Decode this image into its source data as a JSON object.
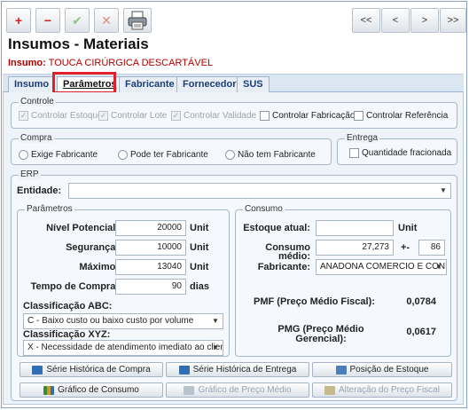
{
  "toolbar": {
    "add_glyph": "+",
    "remove_glyph": "−",
    "confirm_glyph": "✔",
    "cancel_glyph": "✕",
    "nav": [
      "<<",
      "<",
      ">",
      ">>"
    ]
  },
  "header": {
    "title": "Insumos - Materiais",
    "insumo_label": "Insumo:",
    "insumo_value": "TOUCA CIRÚRGICA DESCARTÁVEL"
  },
  "tabs": [
    "Insumo",
    "Parâmetros",
    "Fabricante",
    "Fornecedor",
    "SUS"
  ],
  "controle": {
    "legend": "Controle",
    "items": [
      "Controlar Estoque",
      "Controlar Lote",
      "Controlar Validade",
      "Controlar Fabricação",
      "Controlar Referência"
    ]
  },
  "compra": {
    "legend": "Compra",
    "options": [
      "Exige Fabricante",
      "Pode ter Fabricante",
      "Não tem Fabricante"
    ]
  },
  "entrega": {
    "legend": "Entrega",
    "item": "Quantidade fracionada"
  },
  "erp": {
    "legend": "ERP",
    "entidade_label": "Entidade:",
    "entidade_value": ""
  },
  "parametros": {
    "legend": "Parâmetros",
    "nivel_label": "Nível Potencial:",
    "nivel_value": "20000",
    "nivel_unit": "Unit",
    "seguranca_label": "Segurança:",
    "seguranca_value": "10000",
    "seguranca_unit": "Unit",
    "maximo_label": "Máximo:",
    "maximo_value": "13040",
    "maximo_unit": "Unit",
    "tempo_label": "Tempo de Compra:",
    "tempo_value": "90",
    "tempo_unit": "dias",
    "abc_label": "Classificação ABC:",
    "abc_value": "C - Baixo custo ou baixo custo por volume",
    "xyz_label": "Classificação XYZ:",
    "xyz_value": "X - Necessidade de atendimento imediato ao cliente"
  },
  "consumo": {
    "legend": "Consumo",
    "estoque_label": "Estoque atual:",
    "estoque_value": "",
    "estoque_unit": "Unit",
    "consumo_label_1": "Consumo",
    "consumo_label_2": "médio:",
    "consumo_value": "27,273",
    "plusminus": "+-",
    "consumo_dev": "86",
    "fabricante_label": "Fabricante:",
    "fabricante_value": "ANADONA COMERCIO E CONFEC",
    "pmf_label": "PMF (Preço Médio Fiscal):",
    "pmf_value": "0,0784",
    "pmg_label_1": "PMG (Preço Médio",
    "pmg_label_2": "Gerencial):",
    "pmg_value": "0,0617"
  },
  "buttons": {
    "serie_compra": "Série Histórica de Compra",
    "serie_entrega": "Série Histórica de Entrega",
    "posicao_estoque": "Posição de Estoque",
    "grafico_consumo": "Gráfico de Consumo",
    "grafico_preco": "Gráfico de Preço Médio",
    "alteracao_preco": "Alteração do Preço Fiscal"
  },
  "colors": {
    "accent_red": "#e0202a",
    "tab_text": "#1c3d78"
  }
}
